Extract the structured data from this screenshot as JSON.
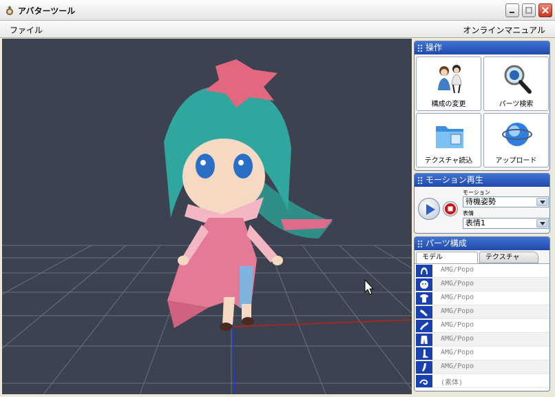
{
  "window": {
    "title": "アバターツール"
  },
  "menu": {
    "file": "ファイル",
    "manual": "オンラインマニュアル"
  },
  "operations": {
    "title": "操作",
    "buttons": [
      {
        "label": "構成の変更",
        "icon": "people-icon"
      },
      {
        "label": "パーツ検索",
        "icon": "magnifier-icon"
      },
      {
        "label": "テクスチャ読込",
        "icon": "folder-icon"
      },
      {
        "label": "アップロード",
        "icon": "globe-icon"
      }
    ]
  },
  "motion": {
    "title": "モーション再生",
    "motion_label": "モーション",
    "motion_value": "待機姿勢",
    "expression_label": "表情",
    "expression_value": "表情1"
  },
  "parts": {
    "title": "パーツ構成",
    "tabs": [
      "モデル",
      "テクスチャ"
    ],
    "rows": [
      {
        "icon": "hair-icon",
        "name": "AMG/Popo"
      },
      {
        "icon": "face-icon",
        "name": "AMG/Popo"
      },
      {
        "icon": "shirt-icon",
        "name": "AMG/Popo"
      },
      {
        "icon": "glove-icon",
        "name": "AMG/Popo"
      },
      {
        "icon": "arm-icon",
        "name": "AMG/Popo"
      },
      {
        "icon": "pants-icon",
        "name": "AMG/Popo"
      },
      {
        "icon": "leg-icon",
        "name": "AMG/Popo"
      },
      {
        "icon": "shoe-icon",
        "name": "AMG/Popo"
      },
      {
        "icon": "body-icon",
        "name": "(素体)"
      }
    ]
  },
  "colors": {
    "panel_header": "#2a59c0",
    "viewport_bg": "#3d4250",
    "grid_line": "#6b707c",
    "x_axis": "#c0201a",
    "y_axis": "#1f3ac8",
    "close_button": "#d6452e"
  }
}
